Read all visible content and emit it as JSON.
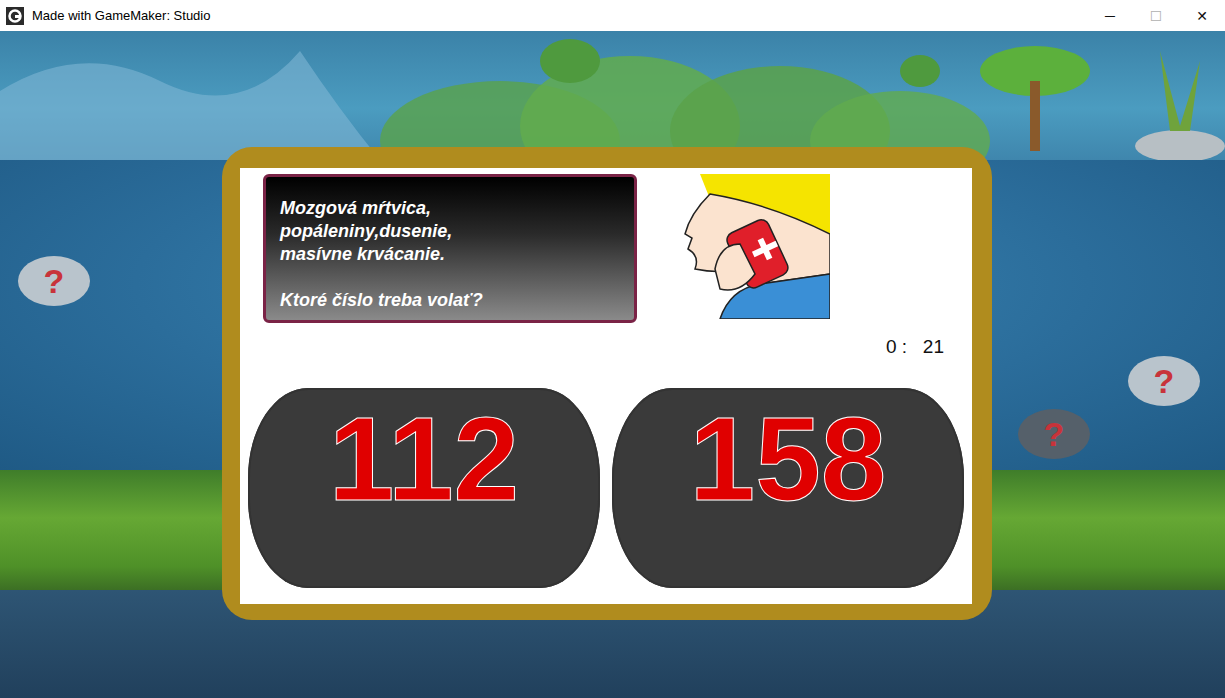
{
  "window": {
    "title": "Made with GameMaker: Studio",
    "controls": [
      "─",
      "☐",
      "✕"
    ]
  },
  "question": {
    "lines": [
      "Mozgová mŕtvica,",
      "popáleniny,dusenie,",
      "masívne krvácanie."
    ],
    "prompt": "Ktoré číslo treba volať?"
  },
  "timer": {
    "reading": "0 :   21"
  },
  "answers": [
    {
      "label": "112"
    },
    {
      "label": "158"
    }
  ],
  "stones": [
    {
      "label": "?"
    },
    {
      "label": "?"
    },
    {
      "label": "?"
    }
  ]
}
